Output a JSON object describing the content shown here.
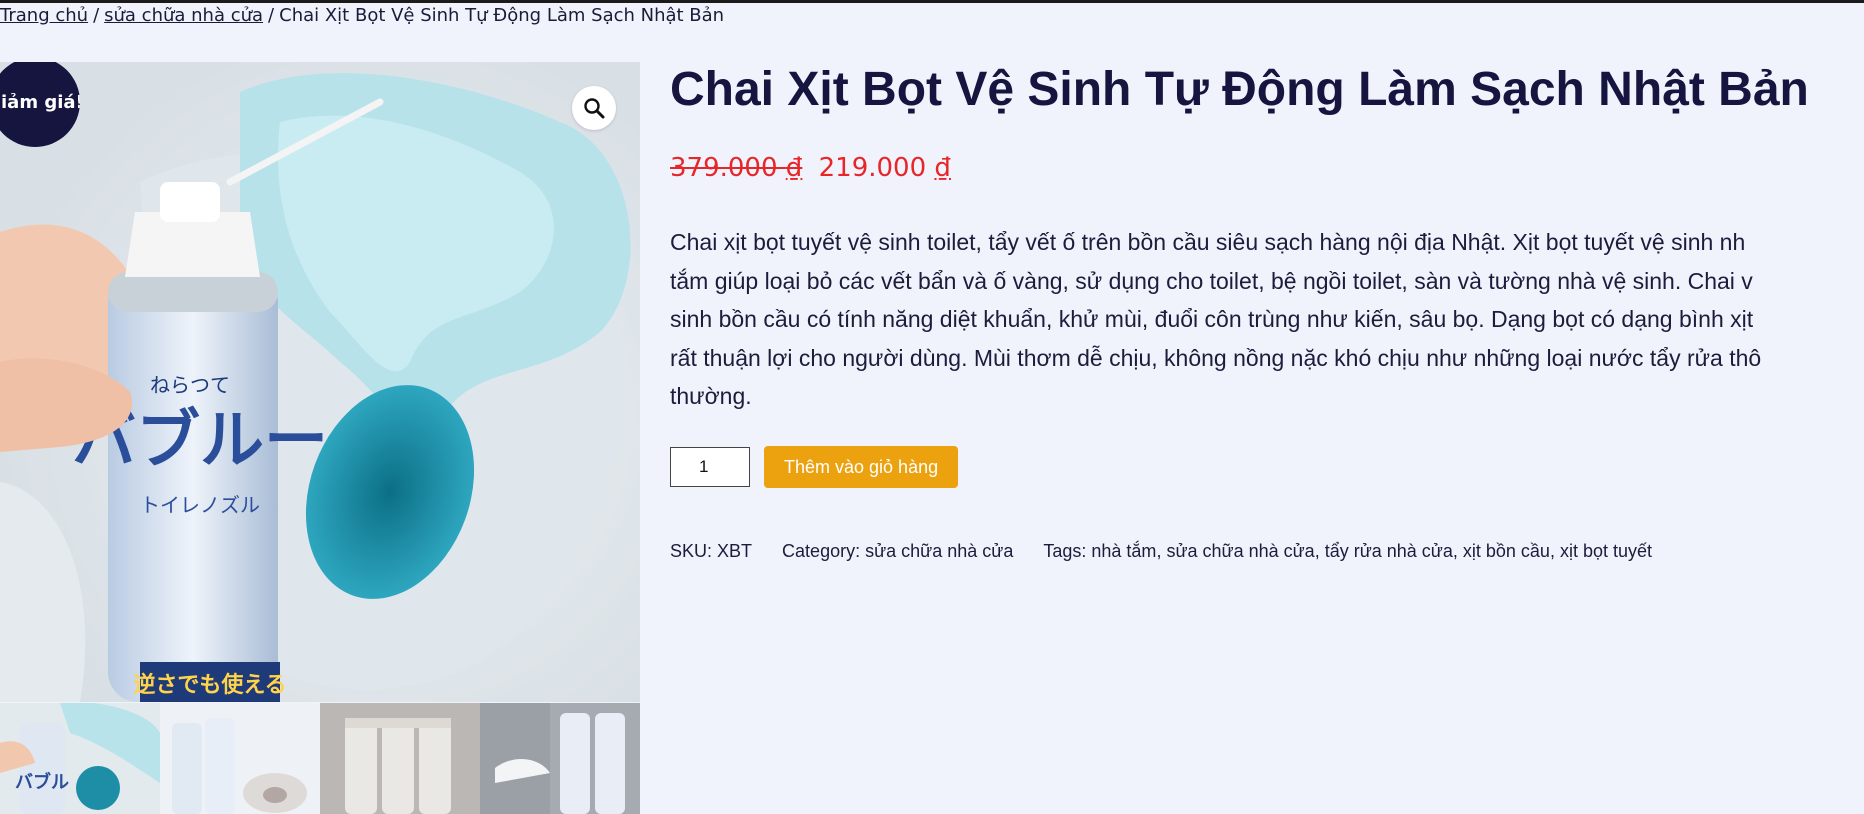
{
  "breadcrumb": {
    "home": "Trang chủ",
    "category": "sửa chữa nhà cửa",
    "separator": "/",
    "current": "Chai Xịt Bọt Vệ Sinh Tự Động Làm Sạch Nhật Bản"
  },
  "gallery": {
    "sale_badge": "Giảm giá!",
    "zoom_icon": "magnifier-icon",
    "can_text_line1": "ねらつて",
    "can_text_big": "バブルー",
    "can_text_sub": "トイレノズル",
    "can_text_bottom": "逆さでも使える",
    "thumbnails": [
      "thumb-1",
      "thumb-2",
      "thumb-3",
      "thumb-4"
    ]
  },
  "product": {
    "title": "Chai Xịt Bọt Vệ Sinh Tự Động Làm Sạch Nhật Bản",
    "price_old": "379.000",
    "price_new": "219.000",
    "currency": "₫",
    "description_lines": [
      "Chai xịt bọt tuyết vệ sinh toilet, tẩy vết ố trên bồn cầu siêu sạch hàng nội địa Nhật. Xịt bọt tuyết vệ sinh nh",
      "tắm giúp loại bỏ các vết bẩn và ố vàng, sử dụng cho toilet, bệ ngồi toilet, sàn và tường nhà vệ sinh. Chai v",
      "sinh bồn cầu có tính năng diệt khuẩn, khử mùi, đuổi côn trùng như kiến, sâu bọ. Dạng bọt có dạng bình xịt",
      "rất thuận lợi cho người dùng. Mùi thơm dễ chịu, không nồng nặc khó chịu như những loại nước tẩy rửa thô",
      "thường."
    ],
    "quantity": "1",
    "add_to_cart": "Thêm vào giỏ hàng"
  },
  "meta": {
    "sku_label": "SKU:",
    "sku": "XBT",
    "category_label": "Category:",
    "category": "sửa chữa nhà cửa",
    "tags_label": "Tags:",
    "tags": [
      "nhà tắm",
      "sửa chữa nhà cửa",
      "tẩy rửa nhà cửa",
      "xịt bồn cầu",
      "xịt bọt tuyết"
    ]
  },
  "colors": {
    "background": "#f0f3fb",
    "title": "#15153f",
    "price": "#e8262a",
    "button": "#eca10f",
    "badge": "#15153f"
  }
}
